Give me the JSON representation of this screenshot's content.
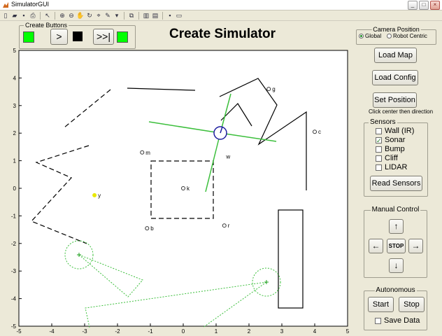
{
  "window": {
    "title": "SimulatorGUI",
    "buttons": [
      "_",
      "□",
      "×"
    ]
  },
  "toolbar": {
    "icons": [
      "new-icon",
      "open-icon",
      "save-icon",
      "print-icon",
      "pointer-icon",
      "zoom-in-icon",
      "zoom-out-icon",
      "pan-icon",
      "rotate-icon",
      "data-cursor-icon",
      "brush-icon",
      "link-icon",
      "colorbar-icon",
      "legend-icon",
      "hide-tools-icon",
      "show-tools-icon"
    ]
  },
  "create_buttons": {
    "legend": "Create Buttons",
    "step_label": ">",
    "skip_label": ">>|",
    "colors": {
      "green": "#00ff00",
      "black": "#000000"
    }
  },
  "page_title": "Create Simulator",
  "camera": {
    "legend": "Camera Position",
    "global_label": "Global",
    "robot_label": "Robot Centric",
    "selected": "Global"
  },
  "buttons": {
    "load_map": "Load Map",
    "load_config": "Load Config",
    "set_position": "Set Position",
    "set_position_hint": "Click center then direction",
    "read_sensors": "Read Sensors"
  },
  "sensors": {
    "legend": "Sensors",
    "items": [
      {
        "label": "Wall (IR)",
        "checked": false
      },
      {
        "label": "Sonar",
        "checked": true
      },
      {
        "label": "Bump",
        "checked": false
      },
      {
        "label": "Cliff",
        "checked": false
      },
      {
        "label": "LIDAR",
        "checked": false
      }
    ]
  },
  "manual": {
    "legend": "Manual Control",
    "up": "↑",
    "down": "↓",
    "left": "←",
    "right": "→",
    "stop": "STOP"
  },
  "autonomous": {
    "legend": "Autonomous",
    "start": "Start",
    "stop": "Stop",
    "save_label": "Save Data",
    "save_checked": false
  },
  "plot": {
    "xlim": [
      -5,
      5
    ],
    "ylim": [
      -5,
      5
    ],
    "xticks": [
      "-5",
      "-4",
      "-3",
      "-2",
      "-1",
      "0",
      "1",
      "2",
      "3",
      "4",
      "5"
    ],
    "yticks": [
      "5",
      "4",
      "3",
      "2",
      "1",
      "0",
      "-1",
      "-2",
      "-3",
      "-4",
      "-5"
    ],
    "beacons": [
      {
        "label": "g",
        "x": 2.6,
        "y": 3.6
      },
      {
        "label": "c",
        "x": 4.0,
        "y": 2.05
      },
      {
        "label": "m",
        "x": -1.25,
        "y": 1.3
      },
      {
        "label": "w",
        "x": 1.2,
        "y": 1.15,
        "marker": false
      },
      {
        "label": "k",
        "x": 0.0,
        "y": 0.0
      },
      {
        "label": "y",
        "x": -2.7,
        "y": -0.25,
        "color": "#e8e800"
      },
      {
        "label": "b",
        "x": -1.1,
        "y": -1.45
      },
      {
        "label": "r",
        "x": 1.25,
        "y": -1.35
      }
    ],
    "robot": {
      "x": 1.15,
      "y": 2.0,
      "radius": 0.2
    }
  }
}
